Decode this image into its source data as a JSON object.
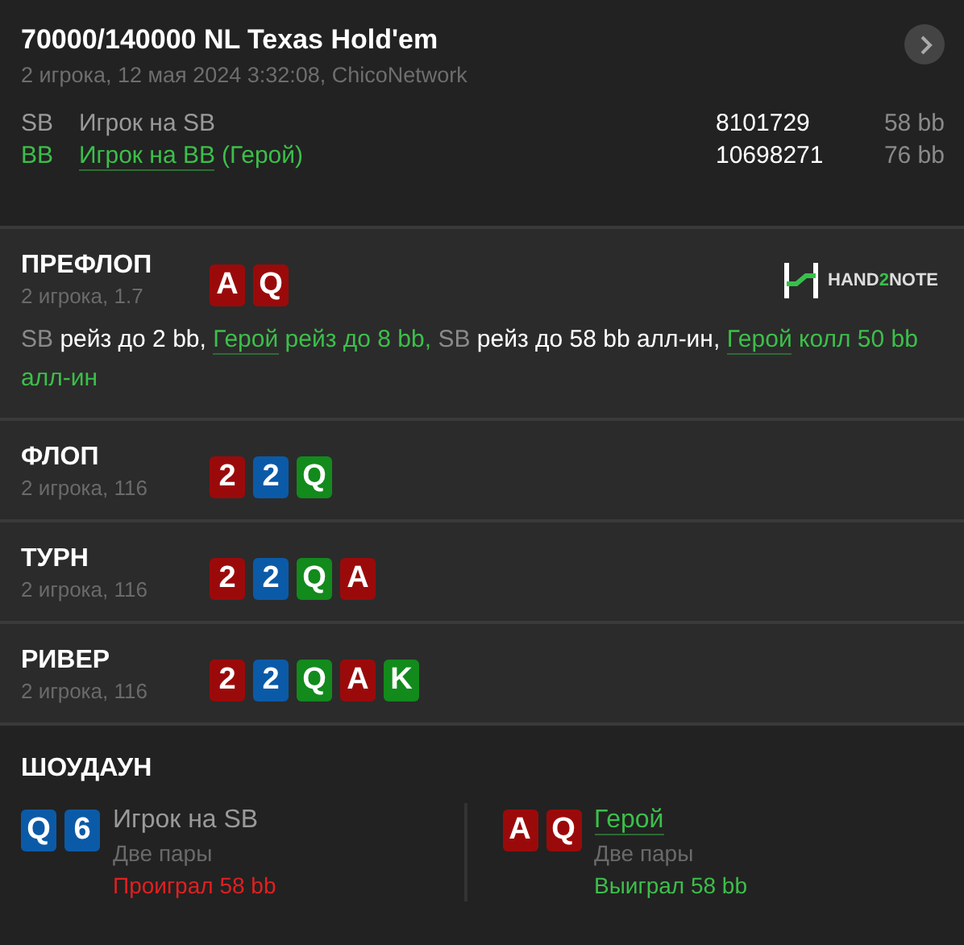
{
  "header": {
    "title": "70000/140000 NL Texas Hold'em",
    "subtitle": "2 игрока, 12 мая 2024 3:32:08, ChicoNetwork"
  },
  "players": [
    {
      "position": "SB",
      "name": "Игрок на SB",
      "hero": false,
      "stack": "8101729",
      "bb": "58 bb"
    },
    {
      "position": "BB",
      "name": "Игрок на BB",
      "hero": true,
      "hero_tag": "(Герой)",
      "stack": "10698271",
      "bb": "76 bb"
    }
  ],
  "streets": [
    {
      "name": "ПРЕФЛОП",
      "info": "2 игрока, 1.7",
      "logo": {
        "before": "HAND",
        "accent": "2",
        "after": "NOTE"
      },
      "cards": [
        {
          "rank": "A",
          "color": "#9b0a0a"
        },
        {
          "rank": "Q",
          "color": "#9b0a0a"
        }
      ],
      "actions": [
        {
          "actor": "SB",
          "hero": false,
          "text": "рейз до 2 bb,"
        },
        {
          "actor": "Герой",
          "hero": true,
          "text": "рейз до 8 bb,"
        },
        {
          "actor": "SB",
          "hero": false,
          "text": "рейз до 58 bb алл-ин,"
        },
        {
          "actor": "Герой",
          "hero": true,
          "text": "колл 50 bb алл-ин"
        }
      ]
    },
    {
      "name": "ФЛОП",
      "info": "2 игрока, 116",
      "cards": [
        {
          "rank": "2",
          "color": "#9b0a0a"
        },
        {
          "rank": "2",
          "color": "#0b5aa8"
        },
        {
          "rank": "Q",
          "color": "#128a1c"
        }
      ]
    },
    {
      "name": "ТУРН",
      "info": "2 игрока, 116",
      "cards": [
        {
          "rank": "2",
          "color": "#9b0a0a"
        },
        {
          "rank": "2",
          "color": "#0b5aa8"
        },
        {
          "rank": "Q",
          "color": "#128a1c"
        },
        {
          "rank": "A",
          "color": "#9b0a0a"
        }
      ]
    },
    {
      "name": "РИВЕР",
      "info": "2 игрока, 116",
      "cards": [
        {
          "rank": "2",
          "color": "#9b0a0a"
        },
        {
          "rank": "2",
          "color": "#0b5aa8"
        },
        {
          "rank": "Q",
          "color": "#128a1c"
        },
        {
          "rank": "A",
          "color": "#9b0a0a"
        },
        {
          "rank": "K",
          "color": "#128a1c"
        }
      ]
    }
  ],
  "showdown": {
    "title": "ШОУДАУН",
    "hands": [
      {
        "name": "Игрок на SB",
        "hero": false,
        "combo": "Две пары",
        "result": "Проиграл 58 bb",
        "won": false,
        "cards": [
          {
            "rank": "Q",
            "color": "#0b5aa8"
          },
          {
            "rank": "6",
            "color": "#0b5aa8"
          }
        ]
      },
      {
        "name": "Герой",
        "hero": true,
        "combo": "Две пары",
        "result": "Выиграл 58 bb",
        "won": true,
        "cards": [
          {
            "rank": "A",
            "color": "#9b0a0a"
          },
          {
            "rank": "Q",
            "color": "#9b0a0a"
          }
        ]
      }
    ]
  }
}
